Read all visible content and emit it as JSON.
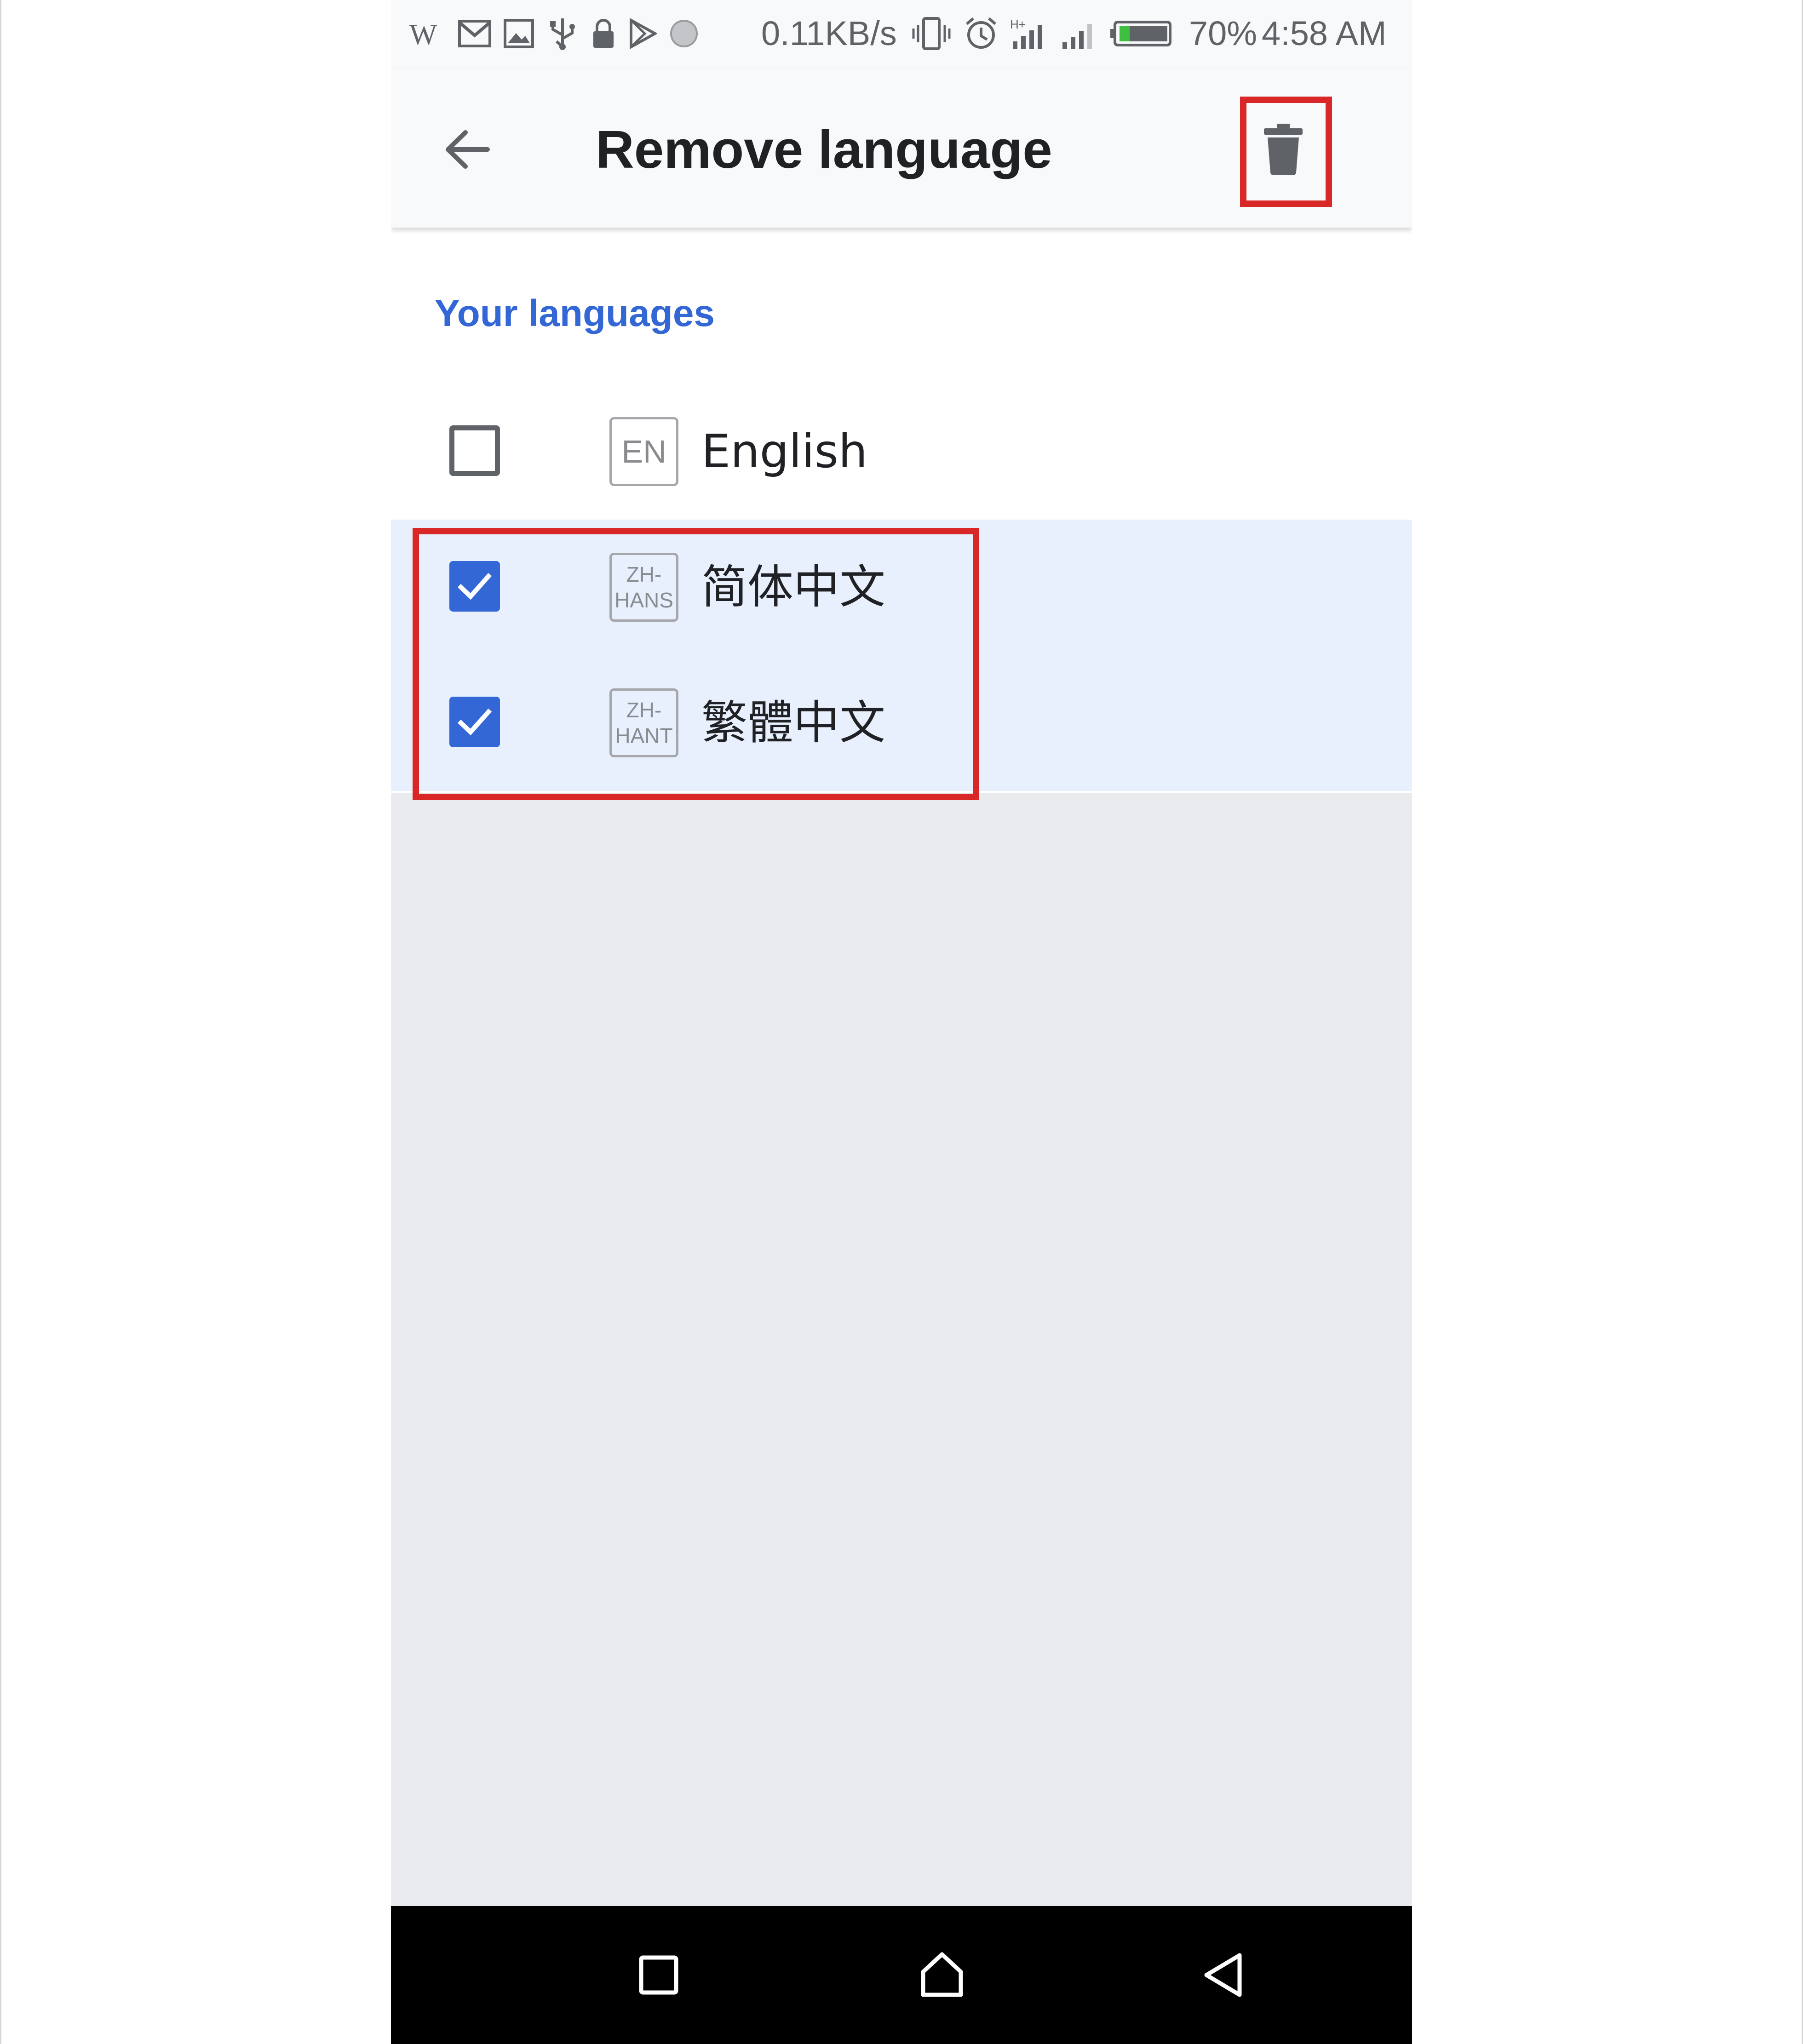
{
  "status_bar": {
    "icons": [
      "wikipedia-icon",
      "gmail-icon",
      "image-icon",
      "usb-icon",
      "lock-icon",
      "play-store-icon",
      "circle-notification-icon",
      "vibrate-icon",
      "alarm-icon",
      "data-signal-icon",
      "signal-bars-icon",
      "battery-icon"
    ],
    "net_speed": "0.11KB/s",
    "battery": "70%",
    "time": "4:58 AM"
  },
  "app_bar": {
    "title": "Remove language",
    "back_icon": "arrow-back-icon",
    "delete_icon": "trash-icon"
  },
  "section": {
    "header": "Your languages"
  },
  "languages": [
    {
      "code_line1": "EN",
      "code_line2": "",
      "name": "English",
      "checked": false
    },
    {
      "code_line1": "ZH-",
      "code_line2": "HANS",
      "name": "简体中文",
      "checked": true
    },
    {
      "code_line1": "ZH-",
      "code_line2": "HANT",
      "name": "繁體中文",
      "checked": true
    }
  ],
  "nav_bar": {
    "buttons": [
      "recents-square-icon",
      "home-icon",
      "back-triangle-icon"
    ]
  },
  "colors": {
    "accent": "#3367d6",
    "selected_row": "#e8f0fe",
    "highlight_box": "#d92626",
    "empty_area": "#eaebee"
  }
}
